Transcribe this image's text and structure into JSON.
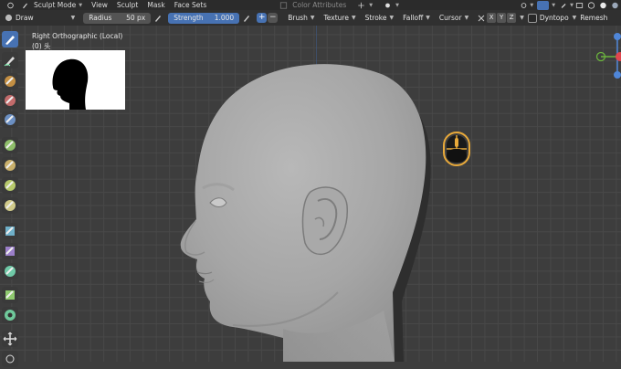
{
  "menubar": {
    "mode": "Sculpt Mode",
    "items": [
      "View",
      "Sculpt",
      "Mask",
      "Face Sets"
    ],
    "color_attributes": "Color Attributes"
  },
  "toolbar": {
    "brush": "Draw",
    "radius_label": "Radius",
    "radius_value": "50 px",
    "strength_label": "Strength",
    "strength_value": "1.000",
    "plus": "+",
    "minus": "−",
    "menus": [
      "Brush",
      "Texture",
      "Stroke",
      "Falloff",
      "Cursor"
    ],
    "axes": [
      "X",
      "Y",
      "Z"
    ],
    "dyntopo": "Dyntopo",
    "remesh": "Remesh"
  },
  "viewport": {
    "view_name": "Right Orthographic (Local)",
    "object_name": "(0) 头"
  },
  "colors": {
    "accent": "#4772b3",
    "mouse_widget": "#e8a93a",
    "gizmo_green": "#6bb33d",
    "gizmo_red": "#e0464e",
    "gizmo_blue": "#4f86d8"
  },
  "icons": {
    "tools": [
      "draw-brush-icon",
      "smooth-brush-icon",
      "clay-strips-icon",
      "inflate-icon",
      "grab-icon",
      "layer-icon",
      "crease-icon",
      "pinch-icon",
      "flatten-icon",
      "scrape-icon",
      "snake-hook-icon",
      "thumb-icon",
      "pose-icon",
      "nudge-icon",
      "rotate-icon",
      "mask-icon",
      "box-mask-icon",
      "transform-icon"
    ]
  }
}
